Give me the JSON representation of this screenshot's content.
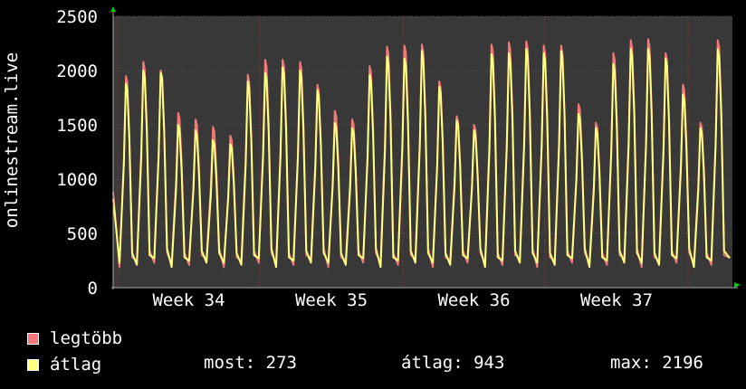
{
  "chart_data": {
    "type": "line",
    "ylabel": "onlinestream.live",
    "ylim": [
      0,
      2500
    ],
    "yticks": [
      0,
      500,
      1000,
      1500,
      2000,
      2500
    ],
    "xticks": [
      "Week 34",
      "Week 35",
      "Week 36",
      "Week 37"
    ],
    "grid": true,
    "legend_position": "bottom",
    "x": [
      1,
      2,
      3,
      4,
      5,
      6,
      7,
      8,
      9,
      10,
      11,
      12,
      13,
      14,
      15,
      16,
      17,
      18,
      19,
      20,
      21,
      22,
      23,
      24,
      25,
      26,
      27,
      28,
      29,
      30,
      31,
      32,
      33,
      34,
      35
    ],
    "series": [
      {
        "name": "legtöbb",
        "color": "#f47a7a",
        "values": [
          1950,
          2080,
          2000,
          1610,
          1550,
          1480,
          1400,
          1960,
          2100,
          2100,
          2080,
          1870,
          1630,
          1550,
          2040,
          2220,
          2230,
          2240,
          1900,
          1580,
          1500,
          2240,
          2260,
          2270,
          2230,
          2230,
          1690,
          1520,
          2160,
          2280,
          2290,
          2160,
          1870,
          1520,
          2280
        ]
      },
      {
        "name": "átlag",
        "color": "#ffff80",
        "values": [
          1880,
          2000,
          1980,
          1500,
          1450,
          1360,
          1320,
          1900,
          1980,
          2030,
          2000,
          1820,
          1520,
          1470,
          1960,
          2130,
          2110,
          2180,
          1850,
          1540,
          1450,
          2150,
          2160,
          2200,
          2160,
          2180,
          1600,
          1470,
          2060,
          2200,
          2200,
          2110,
          1780,
          1470,
          2196
        ]
      }
    ],
    "stats": {
      "most_label": "most:",
      "most_value": "273",
      "atlag_label": "átlag:",
      "atlag_value": "943",
      "max_label": "max:",
      "max_value": "2196"
    }
  }
}
